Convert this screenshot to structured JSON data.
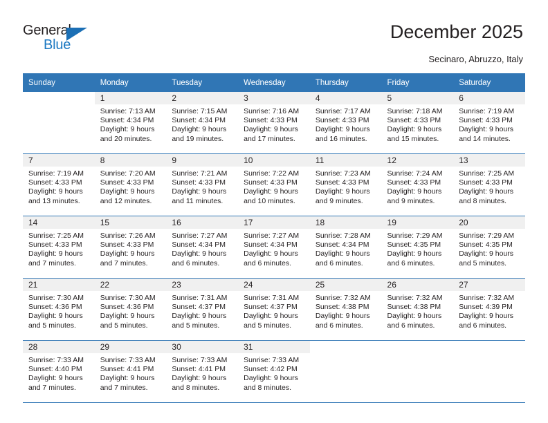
{
  "brand": {
    "name_part1": "General",
    "name_part2": "Blue",
    "triangle_color": "#1b6fb5",
    "blue_text_color": "#1b78c2"
  },
  "header": {
    "title": "December 2025",
    "subtitle": "Secinaro, Abruzzo, Italy",
    "accent_color": "#3076b5",
    "daynum_strip_color": "#f0f0f0"
  },
  "weekdays": [
    "Sunday",
    "Monday",
    "Tuesday",
    "Wednesday",
    "Thursday",
    "Friday",
    "Saturday"
  ],
  "labels": {
    "sunrise": "Sunrise:",
    "sunset": "Sunset:",
    "daylight": "Daylight:"
  },
  "weeks": [
    [
      {
        "day": "",
        "lines": []
      },
      {
        "day": "1",
        "lines": [
          "Sunrise: 7:13 AM",
          "Sunset: 4:34 PM",
          "Daylight: 9 hours",
          "and 20 minutes."
        ]
      },
      {
        "day": "2",
        "lines": [
          "Sunrise: 7:15 AM",
          "Sunset: 4:34 PM",
          "Daylight: 9 hours",
          "and 19 minutes."
        ]
      },
      {
        "day": "3",
        "lines": [
          "Sunrise: 7:16 AM",
          "Sunset: 4:33 PM",
          "Daylight: 9 hours",
          "and 17 minutes."
        ]
      },
      {
        "day": "4",
        "lines": [
          "Sunrise: 7:17 AM",
          "Sunset: 4:33 PM",
          "Daylight: 9 hours",
          "and 16 minutes."
        ]
      },
      {
        "day": "5",
        "lines": [
          "Sunrise: 7:18 AM",
          "Sunset: 4:33 PM",
          "Daylight: 9 hours",
          "and 15 minutes."
        ]
      },
      {
        "day": "6",
        "lines": [
          "Sunrise: 7:19 AM",
          "Sunset: 4:33 PM",
          "Daylight: 9 hours",
          "and 14 minutes."
        ]
      }
    ],
    [
      {
        "day": "7",
        "lines": [
          "Sunrise: 7:19 AM",
          "Sunset: 4:33 PM",
          "Daylight: 9 hours",
          "and 13 minutes."
        ]
      },
      {
        "day": "8",
        "lines": [
          "Sunrise: 7:20 AM",
          "Sunset: 4:33 PM",
          "Daylight: 9 hours",
          "and 12 minutes."
        ]
      },
      {
        "day": "9",
        "lines": [
          "Sunrise: 7:21 AM",
          "Sunset: 4:33 PM",
          "Daylight: 9 hours",
          "and 11 minutes."
        ]
      },
      {
        "day": "10",
        "lines": [
          "Sunrise: 7:22 AM",
          "Sunset: 4:33 PM",
          "Daylight: 9 hours",
          "and 10 minutes."
        ]
      },
      {
        "day": "11",
        "lines": [
          "Sunrise: 7:23 AM",
          "Sunset: 4:33 PM",
          "Daylight: 9 hours",
          "and 9 minutes."
        ]
      },
      {
        "day": "12",
        "lines": [
          "Sunrise: 7:24 AM",
          "Sunset: 4:33 PM",
          "Daylight: 9 hours",
          "and 9 minutes."
        ]
      },
      {
        "day": "13",
        "lines": [
          "Sunrise: 7:25 AM",
          "Sunset: 4:33 PM",
          "Daylight: 9 hours",
          "and 8 minutes."
        ]
      }
    ],
    [
      {
        "day": "14",
        "lines": [
          "Sunrise: 7:25 AM",
          "Sunset: 4:33 PM",
          "Daylight: 9 hours",
          "and 7 minutes."
        ]
      },
      {
        "day": "15",
        "lines": [
          "Sunrise: 7:26 AM",
          "Sunset: 4:33 PM",
          "Daylight: 9 hours",
          "and 7 minutes."
        ]
      },
      {
        "day": "16",
        "lines": [
          "Sunrise: 7:27 AM",
          "Sunset: 4:34 PM",
          "Daylight: 9 hours",
          "and 6 minutes."
        ]
      },
      {
        "day": "17",
        "lines": [
          "Sunrise: 7:27 AM",
          "Sunset: 4:34 PM",
          "Daylight: 9 hours",
          "and 6 minutes."
        ]
      },
      {
        "day": "18",
        "lines": [
          "Sunrise: 7:28 AM",
          "Sunset: 4:34 PM",
          "Daylight: 9 hours",
          "and 6 minutes."
        ]
      },
      {
        "day": "19",
        "lines": [
          "Sunrise: 7:29 AM",
          "Sunset: 4:35 PM",
          "Daylight: 9 hours",
          "and 6 minutes."
        ]
      },
      {
        "day": "20",
        "lines": [
          "Sunrise: 7:29 AM",
          "Sunset: 4:35 PM",
          "Daylight: 9 hours",
          "and 5 minutes."
        ]
      }
    ],
    [
      {
        "day": "21",
        "lines": [
          "Sunrise: 7:30 AM",
          "Sunset: 4:36 PM",
          "Daylight: 9 hours",
          "and 5 minutes."
        ]
      },
      {
        "day": "22",
        "lines": [
          "Sunrise: 7:30 AM",
          "Sunset: 4:36 PM",
          "Daylight: 9 hours",
          "and 5 minutes."
        ]
      },
      {
        "day": "23",
        "lines": [
          "Sunrise: 7:31 AM",
          "Sunset: 4:37 PM",
          "Daylight: 9 hours",
          "and 5 minutes."
        ]
      },
      {
        "day": "24",
        "lines": [
          "Sunrise: 7:31 AM",
          "Sunset: 4:37 PM",
          "Daylight: 9 hours",
          "and 5 minutes."
        ]
      },
      {
        "day": "25",
        "lines": [
          "Sunrise: 7:32 AM",
          "Sunset: 4:38 PM",
          "Daylight: 9 hours",
          "and 6 minutes."
        ]
      },
      {
        "day": "26",
        "lines": [
          "Sunrise: 7:32 AM",
          "Sunset: 4:38 PM",
          "Daylight: 9 hours",
          "and 6 minutes."
        ]
      },
      {
        "day": "27",
        "lines": [
          "Sunrise: 7:32 AM",
          "Sunset: 4:39 PM",
          "Daylight: 9 hours",
          "and 6 minutes."
        ]
      }
    ],
    [
      {
        "day": "28",
        "lines": [
          "Sunrise: 7:33 AM",
          "Sunset: 4:40 PM",
          "Daylight: 9 hours",
          "and 7 minutes."
        ]
      },
      {
        "day": "29",
        "lines": [
          "Sunrise: 7:33 AM",
          "Sunset: 4:41 PM",
          "Daylight: 9 hours",
          "and 7 minutes."
        ]
      },
      {
        "day": "30",
        "lines": [
          "Sunrise: 7:33 AM",
          "Sunset: 4:41 PM",
          "Daylight: 9 hours",
          "and 8 minutes."
        ]
      },
      {
        "day": "31",
        "lines": [
          "Sunrise: 7:33 AM",
          "Sunset: 4:42 PM",
          "Daylight: 9 hours",
          "and 8 minutes."
        ]
      },
      {
        "day": "",
        "lines": []
      },
      {
        "day": "",
        "lines": []
      },
      {
        "day": "",
        "lines": []
      }
    ]
  ]
}
